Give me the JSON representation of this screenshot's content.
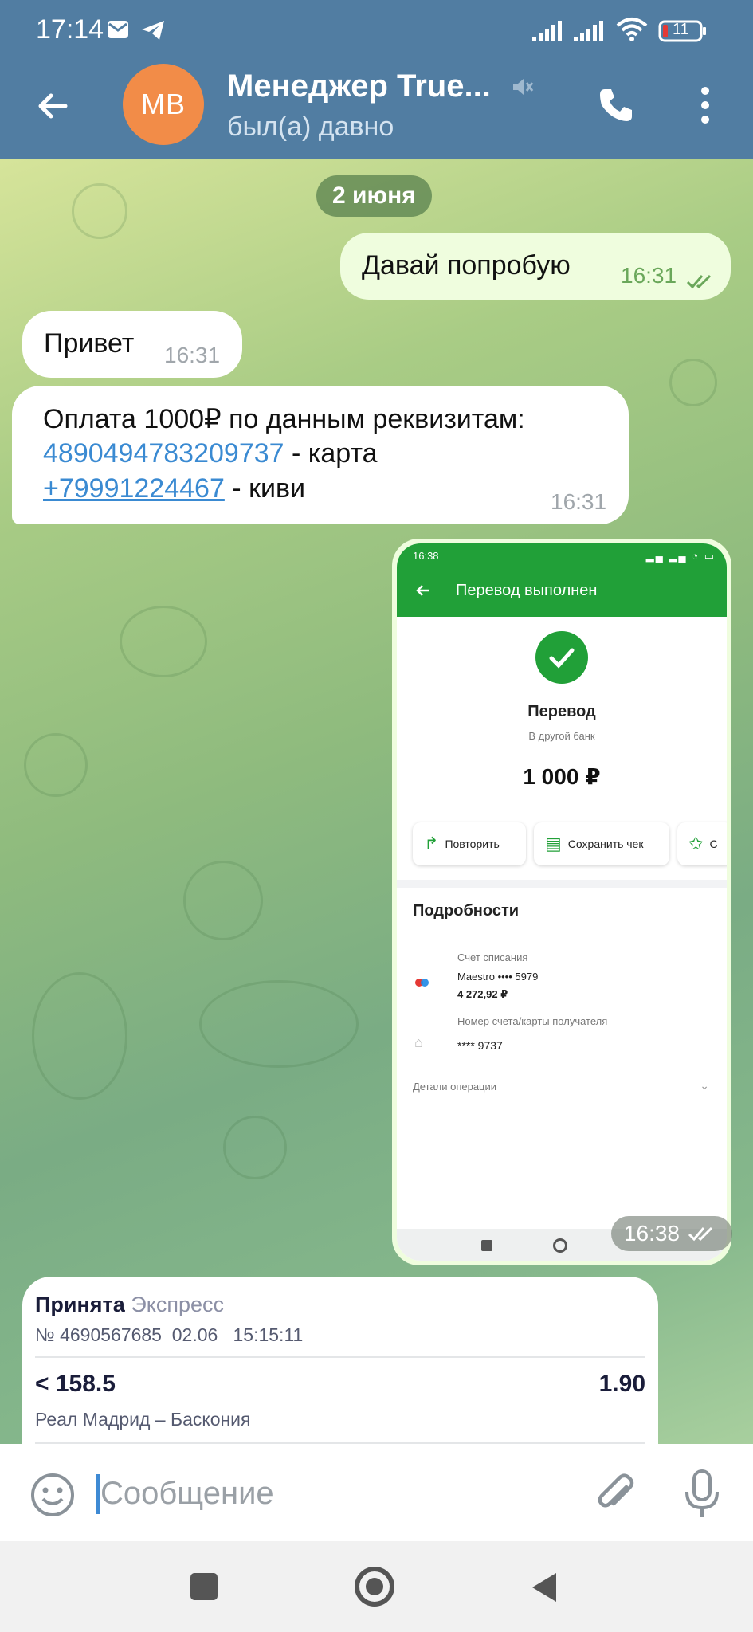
{
  "status_bar": {
    "time": "17:14",
    "battery": "11"
  },
  "header": {
    "avatar_initials": "MB",
    "title": "Менеджер True...",
    "status": "был(а) давно"
  },
  "chat": {
    "date_separator": "2 июня",
    "messages": [
      {
        "dir": "out",
        "text": "Давай попробую",
        "time": "16:31"
      },
      {
        "dir": "in",
        "text": "Привет",
        "time": "16:31"
      },
      {
        "dir": "in",
        "line1": "Оплата 1000₽ по данным реквизитам:",
        "card_number": "4890494783209737",
        "card_suffix": " - карта",
        "phone": "+79991224467",
        "phone_suffix": " - киви",
        "time": "16:31"
      }
    ],
    "image_message": {
      "time": "16:38",
      "screenshot": {
        "status_time": "16:38",
        "header_title": "Перевод выполнен",
        "transfer_title": "Перевод",
        "transfer_subtitle": "В другой банк",
        "amount": "1 000 ₽",
        "buttons": [
          "Повторить",
          "Сохранить чек",
          "С"
        ],
        "details_title": "Подробности",
        "debit_label": "Счет списания",
        "debit_card": "Maestro •••• 5979",
        "debit_balance": "4 272,92 ₽",
        "recipient_label": "Номер счета/карты получателя",
        "recipient_value": "**** 9737",
        "operation_details": "Детали операции"
      }
    },
    "bet_card": {
      "status": "Принята",
      "type": "Экспресс",
      "number": "№ 4690567685",
      "date": "02.06",
      "time": "15:15:11",
      "selection": "< 158.5",
      "odds": "1.90",
      "match": "Реал Мадрид – Баскония"
    }
  },
  "input": {
    "placeholder": "Сообщение"
  },
  "colors": {
    "header_bg": "#517da2",
    "outgoing_bubble": "#effdde",
    "incoming_bubble": "#ffffff",
    "link": "#3a8ad2",
    "sber_green": "#21a038",
    "avatar": "#f28c48"
  }
}
